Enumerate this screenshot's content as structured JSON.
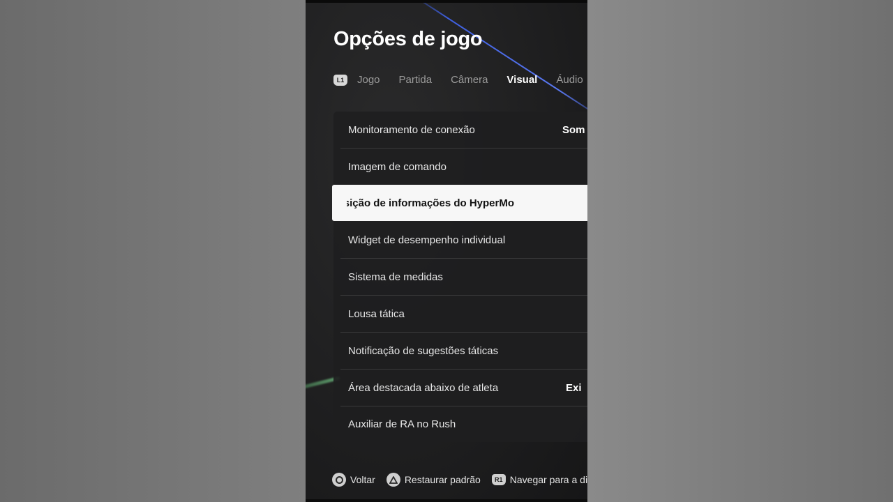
{
  "header": {
    "title": "Opções de jogo"
  },
  "tabs": {
    "hint_left": "L1",
    "items": [
      {
        "label": "Jogo"
      },
      {
        "label": "Partida"
      },
      {
        "label": "Câmera"
      },
      {
        "label": "Visual",
        "active": true
      },
      {
        "label": "Áudio"
      }
    ]
  },
  "settings": {
    "rows": [
      {
        "label": "Monitoramento de conexão",
        "value": "Som"
      },
      {
        "label": "Imagem de comando",
        "value": ""
      },
      {
        "label": "sição de informações do HyperMo",
        "value": "",
        "selected": true
      },
      {
        "label": "Widget de desempenho individual",
        "value": ""
      },
      {
        "label": "Sistema de medidas",
        "value": ""
      },
      {
        "label": "Lousa tática",
        "value": ""
      },
      {
        "label": "Notificação de sugestões táticas",
        "value": ""
      },
      {
        "label": "Área destacada abaixo de atleta",
        "value": "Exi"
      },
      {
        "label": "Auxiliar de RA no Rush",
        "value": ""
      }
    ]
  },
  "footer": {
    "back_label": "Voltar",
    "restore_label": "Restaurar padrão",
    "r1_hint": "R1",
    "navigate_label": "Navegar para a di"
  },
  "colors": {
    "accent_line": "#3e5fe0",
    "selected_row_bg": "#f7f7f7",
    "panel_bg": "#1d1d1e"
  }
}
